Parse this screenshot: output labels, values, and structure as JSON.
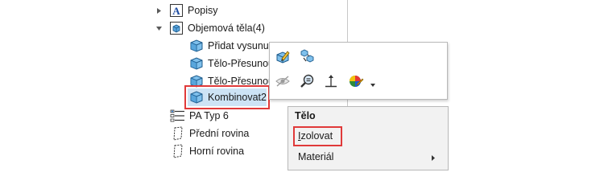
{
  "tree": {
    "items": [
      {
        "label": "Popisy",
        "icon": "annotations-icon",
        "expander": "collapsed"
      },
      {
        "label": "Objemová těla(4)",
        "icon": "solid-bodies-folder-icon",
        "expander": "expanded"
      },
      {
        "label": "Přidat vysunut",
        "icon": "solid-body-icon"
      },
      {
        "label": "Tělo-Přesunou",
        "icon": "solid-body-icon"
      },
      {
        "label": "Tělo-Přesunou",
        "icon": "solid-body-icon"
      },
      {
        "label": "Kombinovat2",
        "icon": "solid-body-icon",
        "selected": true
      },
      {
        "label": "PA Typ 6",
        "icon": "material-icon"
      },
      {
        "label": "Přední rovina",
        "icon": "plane-icon"
      },
      {
        "label": "Horní rovina",
        "icon": "plane-icon"
      }
    ]
  },
  "context_toolbar": {
    "buttons": [
      {
        "icon": "edit-appearance-icon"
      },
      {
        "icon": "isolate-bodies-icon"
      },
      {
        "icon": "hide-icon"
      },
      {
        "icon": "zoom-to-selection-icon"
      },
      {
        "icon": "normal-to-icon"
      },
      {
        "icon": "appearance-icon"
      }
    ]
  },
  "context_menu": {
    "title": "Tělo",
    "items": [
      {
        "label": "Izolovat",
        "mnemonic": "I",
        "rest": "zolovat",
        "highlighted": true
      },
      {
        "label": "Materiál",
        "has_submenu": true
      }
    ]
  },
  "colors": {
    "selection_bg": "#cde3f5",
    "callout_red": "#e03a3a",
    "cube_blue": "#3a8fd0"
  }
}
